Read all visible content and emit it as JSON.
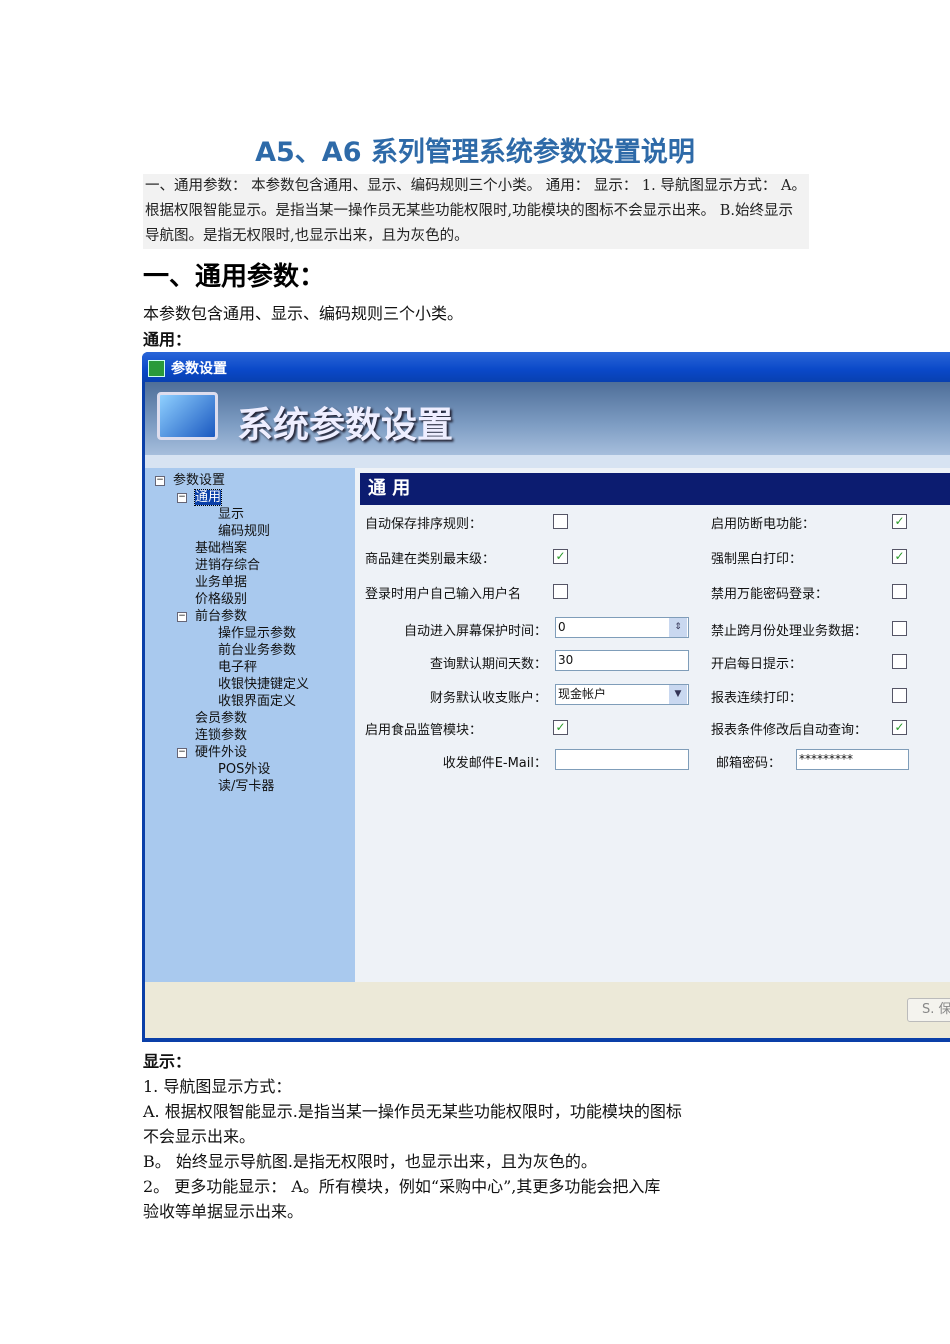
{
  "doc_title": "A5、A6 系列管理系统参数设置说明",
  "summary": "一、通用参数： 本参数包含通用、显示、编码规则三个小类。 通用： 显示： 1. 导航图显示方式： A。根据权限智能显示。是指当某一操作员无某些功能权限时,功能模块的图标不会显示出来。 B.始终显示导航图。是指无权限时,也显示出来，且为灰色的。",
  "section_heading": "一、通用参数：",
  "intro": "本参数包含通用、显示、编码规则三个小类。",
  "general_label": "通用：",
  "window": {
    "title": "参数设置",
    "banner": "系统参数设置",
    "tree": [
      "参数设置",
      "通用",
      "显示",
      "编码规则",
      "基础档案",
      "进销存综合",
      "业务单据",
      "价格级别",
      "前台参数",
      "操作显示参数",
      "前台业务参数",
      "电子秤",
      "收银快捷键定义",
      "收银界面定义",
      "会员参数",
      "连锁参数",
      "硬件外设",
      "POS外设",
      "读/写卡器"
    ],
    "panel_title": "通 用",
    "left_fields": [
      {
        "label": "自动保存排序规则：",
        "checked": false
      },
      {
        "label": "商品建在类别最末级：",
        "checked": true
      },
      {
        "label": "登录时用户自己输入用户名",
        "checked": false
      },
      {
        "label": "自动进入屏幕保护时间：",
        "value": "0"
      },
      {
        "label": "查询默认期间天数：",
        "value": "30"
      },
      {
        "label": "财务默认收支账户：",
        "value": "现金帐户"
      },
      {
        "label": "启用食品监管模块：",
        "checked": true
      },
      {
        "label": "收发邮件E-Mail：",
        "value": ""
      }
    ],
    "right_fields": [
      {
        "label": "启用防断电功能：",
        "checked": true
      },
      {
        "label": "强制黑白打印：",
        "checked": true
      },
      {
        "label": "禁用万能密码登录：",
        "checked": false
      },
      {
        "label": "禁止跨月份处理业务数据：",
        "checked": false
      },
      {
        "label": "开启每日提示：",
        "checked": false
      },
      {
        "label": "报表连续打印：",
        "checked": false
      },
      {
        "label": "报表条件修改后自动查询：",
        "checked": true
      },
      {
        "label": "邮箱密码：",
        "value": "*********"
      }
    ],
    "save_button": "S. 保"
  },
  "display_label": "显示：",
  "lines": [
    "1.  导航图显示方式：",
    "A.   根据权限智能显示.是指当某一操作员无某些功能权限时，功能模块的图标",
    "不会显示出来。",
    "B。  始终显示导航图.是指无权限时，也显示出来，且为灰色的。",
    "2。  更多功能显示：   A。所有模块，例如“采购中心”,其更多功能会把入库",
    "验收等单据显示出来。"
  ]
}
